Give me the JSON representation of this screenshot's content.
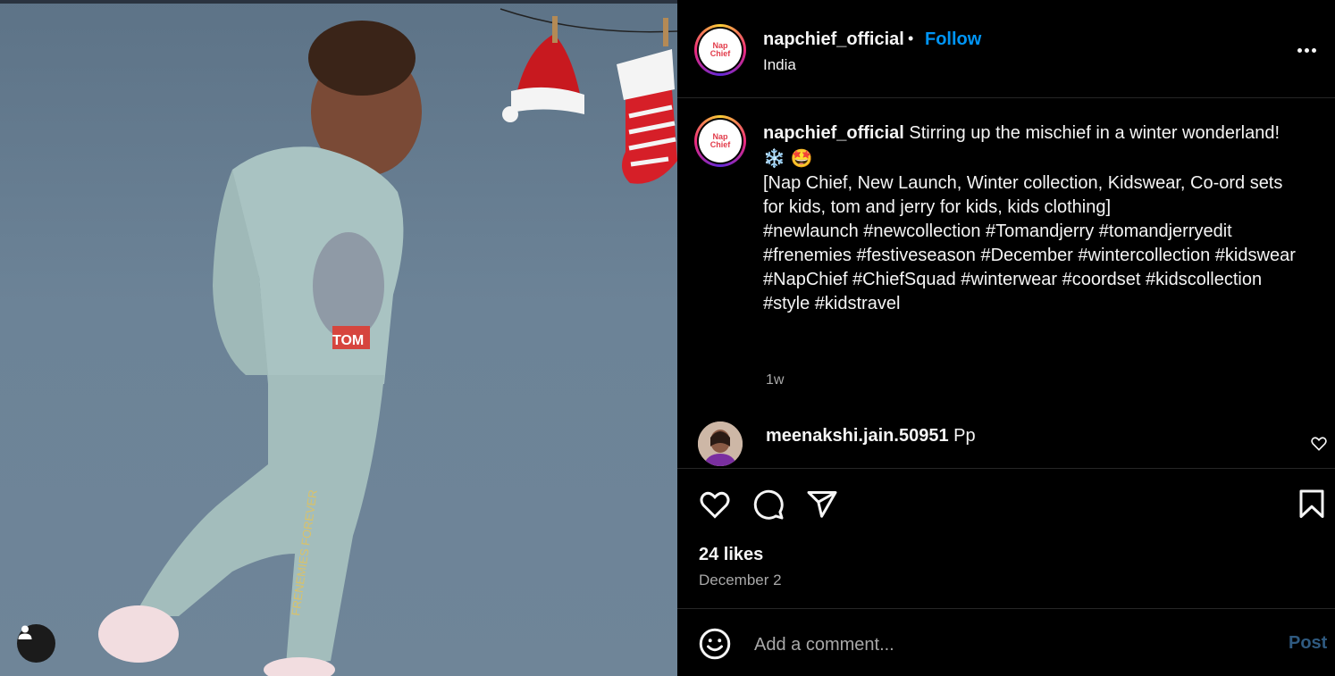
{
  "post": {
    "username": "napchief_official",
    "follow_label": "Follow",
    "separator": "•",
    "location": "India",
    "avatar_text_line1": "Nap",
    "avatar_text_line2": "Chief"
  },
  "caption": {
    "username": "napchief_official",
    "text": "Stirring up the mischief in a winter wonderland!",
    "emoji1": "❄️",
    "emoji2": "🤩",
    "keywords": "[Nap Chief, New Launch, Winter collection, Kidswear, Co-ord sets for kids, tom and jerry for kids, kids clothing]",
    "hashtags": "#newlaunch #newcollection #Tomandjerry #tomandjerryedit #frenemies #festiveseason #December #wintercollection #kidswear #NapChief #ChiefSquad #winterwear #coordset #kidscollection #style #kidstravel",
    "time": "1w"
  },
  "comment": {
    "username": "meenakshi.jain.50951",
    "text": "Pp"
  },
  "actions": {
    "likes": "24 likes",
    "date": "December 2"
  },
  "add_comment": {
    "placeholder": "Add a comment...",
    "post_label": "Post"
  },
  "photo": {
    "shirt_text": "TOM",
    "pants_text": "FRENEMIES FOREVER"
  }
}
